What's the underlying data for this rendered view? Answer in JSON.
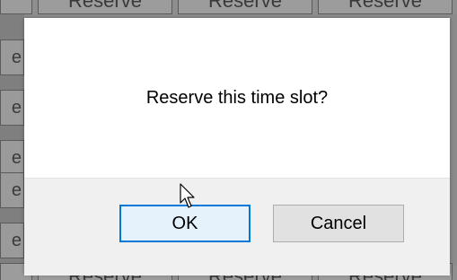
{
  "background": {
    "top_row_buttons": [
      "Reserve",
      "Reserve",
      "Reserve"
    ],
    "bottom_row_buttons": [
      "Reserve",
      "Reserve",
      "Reserve"
    ],
    "side_buttons": [
      "e",
      "e",
      "e",
      "e",
      "e"
    ]
  },
  "dialog": {
    "message": "Reserve this time slot?",
    "ok_label": "OK",
    "cancel_label": "Cancel"
  },
  "colors": {
    "ok_border": "#0078d7",
    "ok_fill": "#e5f1fb",
    "cancel_fill": "#e1e1e1",
    "footer": "#f0f0f0"
  },
  "cursor": "arrow-cursor-icon"
}
